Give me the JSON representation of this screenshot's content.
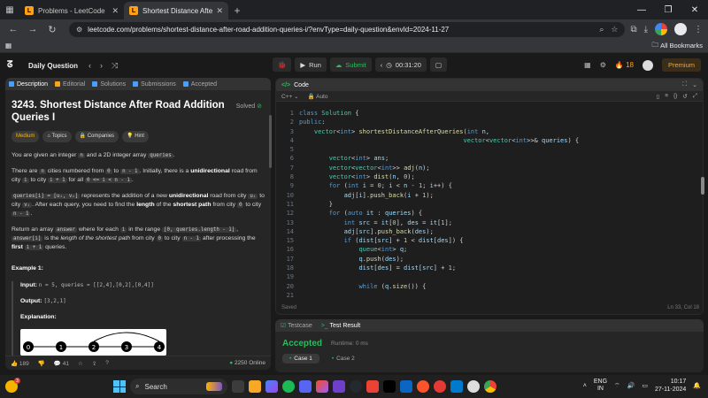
{
  "browser": {
    "tabs": [
      {
        "title": "Problems - LeetCode"
      },
      {
        "title": "Shortest Distance After Road A"
      }
    ],
    "url": "leetcode.com/problems/shortest-distance-after-road-addition-queries-i/?envType=daily-question&envId=2024-11-27",
    "bookmarks_label": "All Bookmarks"
  },
  "lc_header": {
    "daily_label": "Daily Question",
    "run_label": "Run",
    "submit_label": "Submit",
    "timer": "00:31:20",
    "streak": "18",
    "premium_label": "Premium"
  },
  "left_panel": {
    "tabs": [
      {
        "label": "Description",
        "color": "#4a9eff"
      },
      {
        "label": "Editorial",
        "color": "#ffa116"
      },
      {
        "label": "Solutions",
        "color": "#4a9eff"
      },
      {
        "label": "Submissions",
        "color": "#4a9eff"
      },
      {
        "label": "Accepted",
        "color": "#4a9eff"
      }
    ],
    "title": "3243. Shortest Distance After Road Addition Queries I",
    "solved_label": "Solved",
    "chips": [
      "Medium",
      "Topics",
      "Companies",
      "Hint"
    ],
    "p1_a": "You are given an integer ",
    "p1_n": "n",
    "p1_b": " and a 2D integer array ",
    "p1_q": "queries",
    "p1_c": ".",
    "p2_a": "There are ",
    "p2_n": "n",
    "p2_b": " cities numbered from ",
    "p2_z": "0",
    "p2_c": " to ",
    "p2_nm1": "n - 1",
    "p2_d": ". Initially, there is a ",
    "p2_uni": "unidirectional",
    "p2_e": " road from city ",
    "p2_i": "i",
    "p2_f": " to city ",
    "p2_ip1": "i + 1",
    "p2_g": " for all ",
    "p2_range": "0 <= i < n - 1",
    "p2_h": ".",
    "p3_q": "queries[i] = [uᵢ, vᵢ]",
    "p3_a": " represents the addition of a new ",
    "p3_uni": "unidirectional",
    "p3_b": " road from city ",
    "p3_u": "uᵢ",
    "p3_c": " to city ",
    "p3_v": "vᵢ",
    "p3_d": ". After each query, you need to find the ",
    "p3_len": "length",
    "p3_e": " of the ",
    "p3_sp": "shortest path",
    "p3_f": " from city ",
    "p3_z": "0",
    "p3_g": " to city ",
    "p3_nm1": "n - 1",
    "p3_h": ".",
    "p4_a": "Return an array ",
    "p4_ans": "answer",
    "p4_b": " where for each ",
    "p4_i": "i",
    "p4_c": " in the range ",
    "p4_range": "[0, queries.length - 1]",
    "p4_d": ", ",
    "p4_ansi": "answer[i]",
    "p4_e": " is the ",
    "p4_it": "length of the shortest path",
    "p4_f": " from city ",
    "p4_z": "0",
    "p4_g": " to city ",
    "p4_nm1": "n - 1",
    "p4_h": " after processing the ",
    "p4_first": "first",
    "p4_ip1": "i + 1",
    "p4_j": " queries.",
    "example_title": "Example 1:",
    "input_label": "Input:",
    "input_value": "n = 5, queries = [[2,4],[0,2],[0,4]]",
    "output_label": "Output:",
    "output_value": "[3,2,1]",
    "explanation_label": "Explanation:",
    "graph_nodes": [
      "0",
      "1",
      "2",
      "3",
      "4"
    ],
    "footer": {
      "likes": "189",
      "comments": "41",
      "online": "2250 Online"
    }
  },
  "code_panel": {
    "title": "Code",
    "language": "C++",
    "mode": "Auto",
    "saved_label": "Saved",
    "cursor_pos": "Ln 33, Col 18",
    "lines": [
      {
        "n": "1",
        "html": "<span class='kw'>class</span> <span class='ty'>Solution</span> {"
      },
      {
        "n": "2",
        "html": "<span class='kw'>public</span>:"
      },
      {
        "n": "3",
        "html": "    <span class='ty'>vector</span>&lt;<span class='kw'>int</span>&gt; <span class='fn'>shortestDistanceAfterQueries</span>(<span class='kw'>int</span> <span class='var'>n</span>,"
      },
      {
        "n": "4",
        "html": "                                            <span class='ty'>vector</span>&lt;<span class='ty'>vector</span>&lt;<span class='kw'>int</span>&gt;&gt;&amp; <span class='var'>queries</span>) {"
      },
      {
        "n": "5",
        "html": ""
      },
      {
        "n": "6",
        "html": "        <span class='ty'>vector</span>&lt;<span class='kw'>int</span>&gt; <span class='var'>ans</span>;"
      },
      {
        "n": "7",
        "html": "        <span class='ty'>vector</span>&lt;<span class='ty'>vector</span>&lt;<span class='kw'>int</span>&gt;&gt; <span class='fn'>adj</span>(<span class='var'>n</span>);"
      },
      {
        "n": "8",
        "html": "        <span class='ty'>vector</span>&lt;<span class='kw'>int</span>&gt; <span class='fn'>dist</span>(<span class='var'>n</span>, <span class='nm'>0</span>);"
      },
      {
        "n": "9",
        "html": "        <span class='kw'>for</span> (<span class='kw'>int</span> <span class='var'>i</span> = <span class='nm'>0</span>; <span class='var'>i</span> &lt; <span class='var'>n</span> - <span class='nm'>1</span>; <span class='var'>i</span>++) {"
      },
      {
        "n": "10",
        "html": "            <span class='var'>adj</span>[<span class='var'>i</span>].<span class='fn'>push_back</span>(<span class='var'>i</span> + <span class='nm'>1</span>);"
      },
      {
        "n": "11",
        "html": "        }"
      },
      {
        "n": "12",
        "html": "        <span class='kw'>for</span> (<span class='kw'>auto</span> <span class='var'>it</span> : <span class='var'>queries</span>) {"
      },
      {
        "n": "13",
        "html": "            <span class='kw'>int</span> <span class='var'>src</span> = <span class='var'>it</span>[<span class='nm'>0</span>], <span class='var'>des</span> = <span class='var'>it</span>[<span class='nm'>1</span>];"
      },
      {
        "n": "14",
        "html": "            <span class='var'>adj</span>[<span class='var'>src</span>].<span class='fn'>push_back</span>(<span class='var'>des</span>);"
      },
      {
        "n": "15",
        "html": "            <span class='kw'>if</span> (<span class='var'>dist</span>[<span class='var'>src</span>] + <span class='nm'>1</span> &lt; <span class='var'>dist</span>[<span class='var'>des</span>]) {"
      },
      {
        "n": "16",
        "html": "                <span class='ty'>queue</span>&lt;<span class='kw'>int</span>&gt; <span class='var'>q</span>;"
      },
      {
        "n": "17",
        "html": "                <span class='var'>q</span>.<span class='fn'>push</span>(<span class='var'>des</span>);"
      },
      {
        "n": "18",
        "html": "                <span class='var'>dist</span>[<span class='var'>des</span>] = <span class='var'>dist</span>[<span class='var'>src</span>] + <span class='nm'>1</span>;"
      },
      {
        "n": "19",
        "html": ""
      },
      {
        "n": "20",
        "html": "                <span class='kw'>while</span> (<span class='var'>q</span>.<span class='fn'>size</span>()) {"
      },
      {
        "n": "21",
        "html": ""
      }
    ]
  },
  "test_panel": {
    "tab_testcase": "Testcase",
    "tab_result": "Test Result",
    "status": "Accepted",
    "runtime": "Runtime: 0 ms",
    "cases": [
      "Case 1",
      "Case 2"
    ]
  },
  "taskbar": {
    "search_label": "Search",
    "lang": "ENG",
    "region": "IN",
    "time": "10:17",
    "date": "27-11-2024",
    "weather_badge": "3"
  }
}
